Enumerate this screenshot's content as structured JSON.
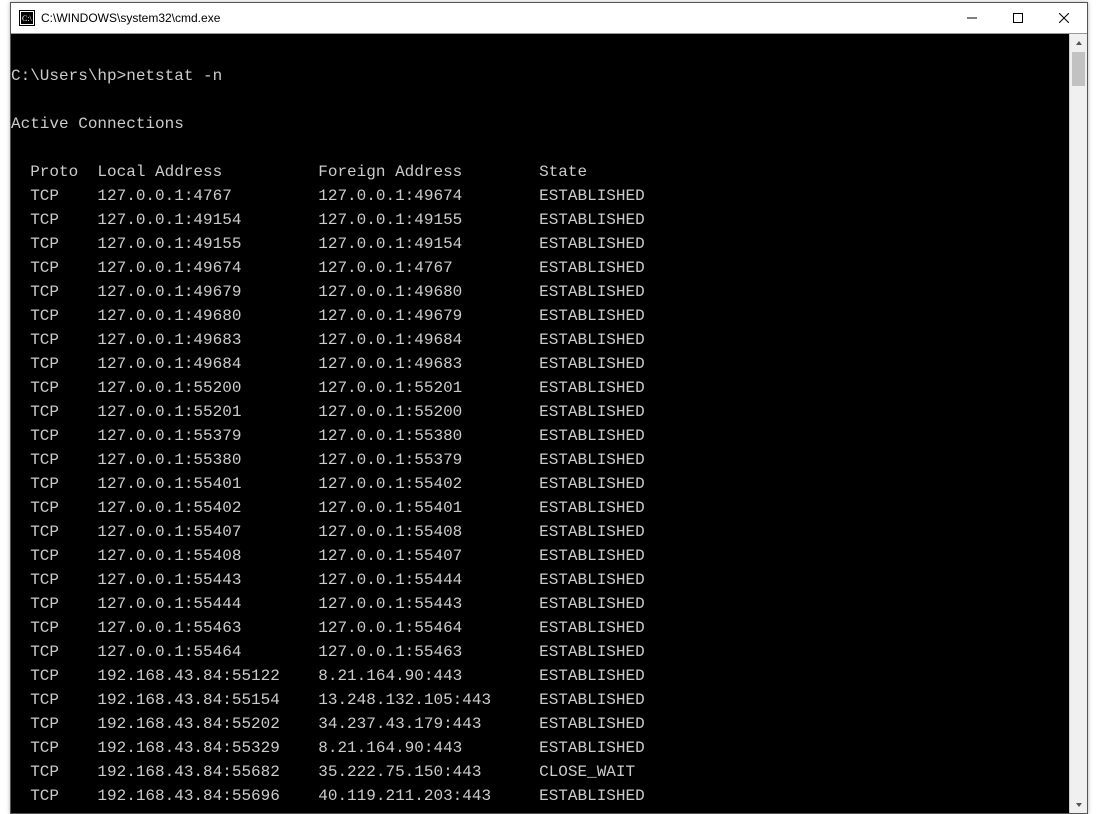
{
  "window": {
    "title": "C:\\WINDOWS\\system32\\cmd.exe"
  },
  "console": {
    "prompt": "C:\\Users\\hp>",
    "command": "netstat -n",
    "section_title": "Active Connections",
    "headers": {
      "proto": "Proto",
      "local": "Local Address",
      "foreign": "Foreign Address",
      "state": "State"
    },
    "rows": [
      {
        "proto": "TCP",
        "local": "127.0.0.1:4767",
        "foreign": "127.0.0.1:49674",
        "state": "ESTABLISHED"
      },
      {
        "proto": "TCP",
        "local": "127.0.0.1:49154",
        "foreign": "127.0.0.1:49155",
        "state": "ESTABLISHED"
      },
      {
        "proto": "TCP",
        "local": "127.0.0.1:49155",
        "foreign": "127.0.0.1:49154",
        "state": "ESTABLISHED"
      },
      {
        "proto": "TCP",
        "local": "127.0.0.1:49674",
        "foreign": "127.0.0.1:4767",
        "state": "ESTABLISHED"
      },
      {
        "proto": "TCP",
        "local": "127.0.0.1:49679",
        "foreign": "127.0.0.1:49680",
        "state": "ESTABLISHED"
      },
      {
        "proto": "TCP",
        "local": "127.0.0.1:49680",
        "foreign": "127.0.0.1:49679",
        "state": "ESTABLISHED"
      },
      {
        "proto": "TCP",
        "local": "127.0.0.1:49683",
        "foreign": "127.0.0.1:49684",
        "state": "ESTABLISHED"
      },
      {
        "proto": "TCP",
        "local": "127.0.0.1:49684",
        "foreign": "127.0.0.1:49683",
        "state": "ESTABLISHED"
      },
      {
        "proto": "TCP",
        "local": "127.0.0.1:55200",
        "foreign": "127.0.0.1:55201",
        "state": "ESTABLISHED"
      },
      {
        "proto": "TCP",
        "local": "127.0.0.1:55201",
        "foreign": "127.0.0.1:55200",
        "state": "ESTABLISHED"
      },
      {
        "proto": "TCP",
        "local": "127.0.0.1:55379",
        "foreign": "127.0.0.1:55380",
        "state": "ESTABLISHED"
      },
      {
        "proto": "TCP",
        "local": "127.0.0.1:55380",
        "foreign": "127.0.0.1:55379",
        "state": "ESTABLISHED"
      },
      {
        "proto": "TCP",
        "local": "127.0.0.1:55401",
        "foreign": "127.0.0.1:55402",
        "state": "ESTABLISHED"
      },
      {
        "proto": "TCP",
        "local": "127.0.0.1:55402",
        "foreign": "127.0.0.1:55401",
        "state": "ESTABLISHED"
      },
      {
        "proto": "TCP",
        "local": "127.0.0.1:55407",
        "foreign": "127.0.0.1:55408",
        "state": "ESTABLISHED"
      },
      {
        "proto": "TCP",
        "local": "127.0.0.1:55408",
        "foreign": "127.0.0.1:55407",
        "state": "ESTABLISHED"
      },
      {
        "proto": "TCP",
        "local": "127.0.0.1:55443",
        "foreign": "127.0.0.1:55444",
        "state": "ESTABLISHED"
      },
      {
        "proto": "TCP",
        "local": "127.0.0.1:55444",
        "foreign": "127.0.0.1:55443",
        "state": "ESTABLISHED"
      },
      {
        "proto": "TCP",
        "local": "127.0.0.1:55463",
        "foreign": "127.0.0.1:55464",
        "state": "ESTABLISHED"
      },
      {
        "proto": "TCP",
        "local": "127.0.0.1:55464",
        "foreign": "127.0.0.1:55463",
        "state": "ESTABLISHED"
      },
      {
        "proto": "TCP",
        "local": "192.168.43.84:55122",
        "foreign": "8.21.164.90:443",
        "state": "ESTABLISHED"
      },
      {
        "proto": "TCP",
        "local": "192.168.43.84:55154",
        "foreign": "13.248.132.105:443",
        "state": "ESTABLISHED"
      },
      {
        "proto": "TCP",
        "local": "192.168.43.84:55202",
        "foreign": "34.237.43.179:443",
        "state": "ESTABLISHED"
      },
      {
        "proto": "TCP",
        "local": "192.168.43.84:55329",
        "foreign": "8.21.164.90:443",
        "state": "ESTABLISHED"
      },
      {
        "proto": "TCP",
        "local": "192.168.43.84:55682",
        "foreign": "35.222.75.150:443",
        "state": "CLOSE_WAIT"
      },
      {
        "proto": "TCP",
        "local": "192.168.43.84:55696",
        "foreign": "40.119.211.203:443",
        "state": "ESTABLISHED"
      }
    ]
  }
}
